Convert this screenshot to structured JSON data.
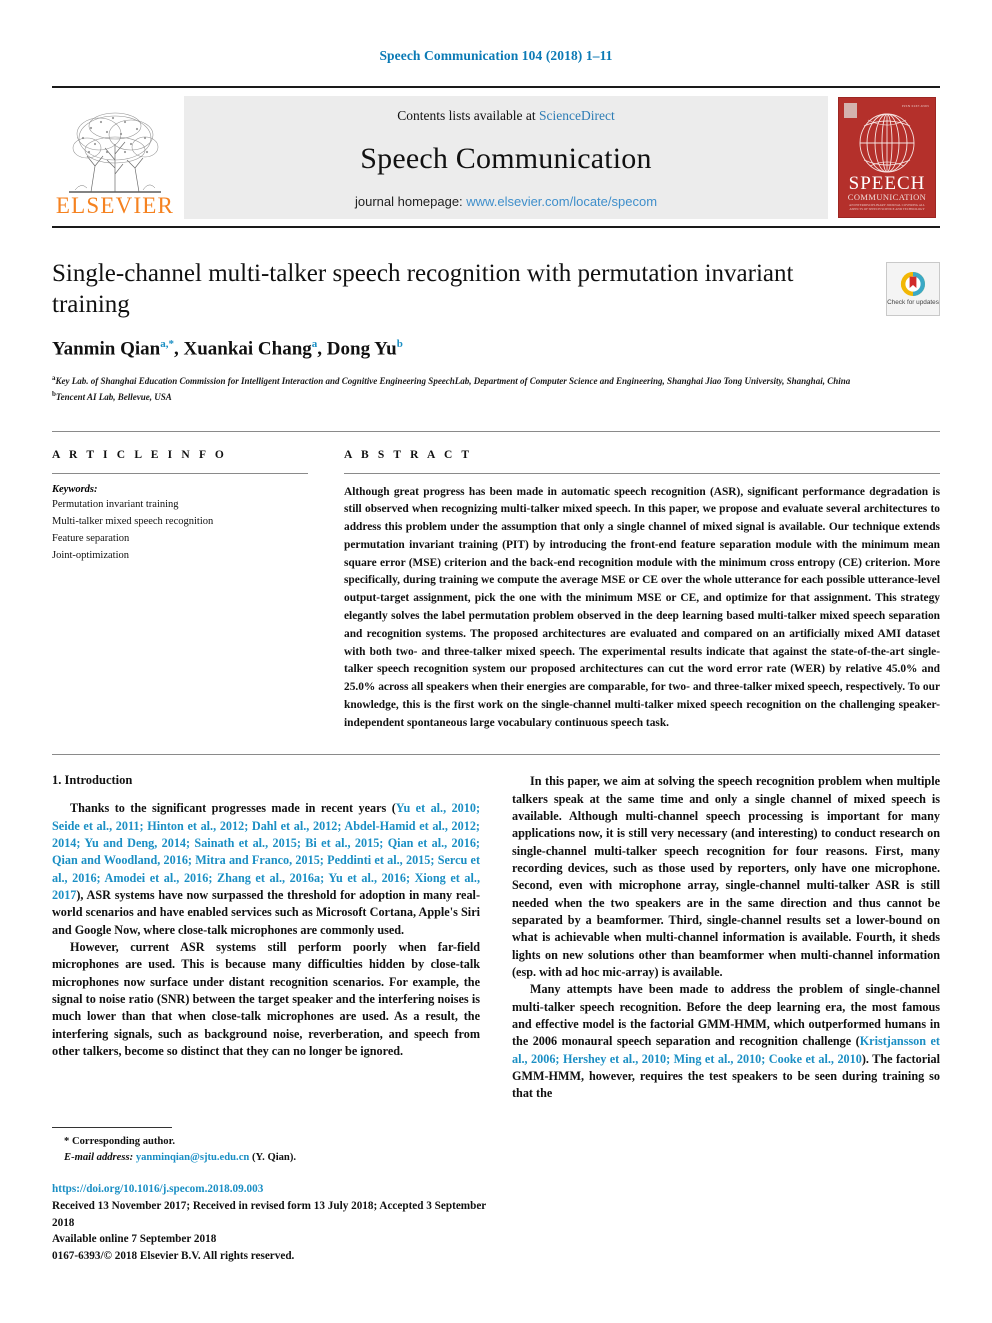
{
  "running_head": "Speech Communication 104 (2018) 1–11",
  "masthead": {
    "publisher_name": "ELSEVIER",
    "contents_prefix": "Contents lists available at ",
    "contents_link": "ScienceDirect",
    "journal_title": "Speech Communication",
    "homepage_prefix": "journal homepage: ",
    "homepage_link": "www.elsevier.com/locate/specom",
    "cover": {
      "title_line1": "SPEECH",
      "title_line2": "COMMUNICATION",
      "fineprint": "AN INTERDISCIPLINARY JOURNAL COVERING ALL ASPECTS OF SPEECH SCIENCE AND TECHNOLOGY",
      "corner_text": "ISSN 0167-6393"
    }
  },
  "article": {
    "title": "Single-channel multi-talker speech recognition with permutation invariant training",
    "crossmark_label": "Check for updates",
    "authors": [
      {
        "name": "Yanmin Qian",
        "marks": "a,*"
      },
      {
        "name": "Xuankai Chang",
        "marks": "a"
      },
      {
        "name": "Dong Yu",
        "marks": "b"
      }
    ],
    "affiliations": [
      {
        "mark": "a",
        "text": "Key Lab. of Shanghai Education Commission for Intelligent Interaction and Cognitive Engineering SpeechLab, Department of Computer Science and Engineering, Shanghai Jiao Tong University, Shanghai, China"
      },
      {
        "mark": "b",
        "text": "Tencent AI Lab, Bellevue, USA"
      }
    ]
  },
  "article_info": {
    "heading": "A R T I C L E   I N F O",
    "keywords_label": "Keywords:",
    "keywords": [
      "Permutation invariant training",
      "Multi-talker mixed speech recognition",
      "Feature separation",
      "Joint-optimization"
    ]
  },
  "abstract": {
    "heading": "A B S T R A C T",
    "text": "Although great progress has been made in automatic speech recognition (ASR), significant performance degradation is still observed when recognizing multi-talker mixed speech. In this paper, we propose and evaluate several architectures to address this problem under the assumption that only a single channel of mixed signal is available. Our technique extends permutation invariant training (PIT) by introducing the front-end feature separation module with the minimum mean square error (MSE) criterion and the back-end recognition module with the minimum cross entropy (CE) criterion. More specifically, during training we compute the average MSE or CE over the whole utterance for each possible utterance-level output-target assignment, pick the one with the minimum MSE or CE, and optimize for that assignment. This strategy elegantly solves the label permutation problem observed in the deep learning based multi-talker mixed speech separation and recognition systems. The proposed architectures are evaluated and compared on an artificially mixed AMI dataset with both two- and three-talker mixed speech. The experimental results indicate that against the state-of-the-art single-talker speech recognition system our proposed architectures can cut the word error rate (WER) by relative 45.0% and 25.0% across all speakers when their energies are comparable, for two- and three-talker mixed speech, respectively. To our knowledge, this is the first work on the single-channel multi-talker mixed speech recognition on the challenging speaker-independent spontaneous large vocabulary continuous speech task."
  },
  "introduction": {
    "section_title": "1. Introduction",
    "left_paragraphs": [
      {
        "segments": [
          {
            "t": "Thanks to the significant progresses made in recent years (",
            "cite": false
          },
          {
            "t": "Yu et al., 2010; Seide et al., 2011; Hinton et al., 2012; Dahl et al., 2012; Abdel-Hamid et al., 2012; 2014; Yu and Deng, 2014; Sainath et al., 2015; Bi et al., 2015; Qian et al., 2016; Qian and Woodland, 2016; Mitra and Franco, 2015; Peddinti et al., 2015; Sercu et al., 2016; Amodei et al., 2016; Zhang et al., 2016a; Yu et al., 2016; Xiong et al., 2017",
            "cite": true
          },
          {
            "t": "), ASR systems have now surpassed the threshold for adoption in many real-world scenarios and have enabled services such as Microsoft Cortana, Apple's Siri and Google Now, where close-talk microphones are commonly used.",
            "cite": false
          }
        ]
      },
      {
        "segments": [
          {
            "t": "However, current ASR systems still perform poorly when far-field microphones are used. This is because many difficulties hidden by close-talk microphones now surface under distant recognition scenarios. For example, the signal to noise ratio (SNR) between the target speaker and the interfering noises is much lower than that when close-talk microphones are used. As a result, the interfering signals, such as background noise, reverberation, and speech from other talkers, become so distinct that they can no longer be ignored.",
            "cite": false
          }
        ]
      }
    ],
    "right_paragraphs": [
      {
        "segments": [
          {
            "t": "In this paper, we aim at solving the speech recognition problem when multiple talkers speak at the same time and only a single channel of mixed speech is available. Although multi-channel speech processing is important for many applications now, it is still very necessary (and interesting) to conduct research on single-channel multi-talker speech recognition for four reasons. First, many recording devices, such as those used by reporters, only have one microphone. Second, even with microphone array, single-channel multi-talker ASR is still needed when the two speakers are in the same direction and thus cannot be separated by a beamformer. Third, single-channel results set a lower-bound on what is achievable when multi-channel information is available. Fourth, it sheds lights on new solutions other than beamformer when multi-channel information (esp. with ad hoc mic-array) is available.",
            "cite": false
          }
        ]
      },
      {
        "segments": [
          {
            "t": "Many attempts have been made to address the problem of single-channel multi-talker speech recognition. Before the deep learning era, the most famous and effective model is the factorial GMM-HMM, which outperformed humans in the 2006 monaural speech separation and recognition challenge (",
            "cite": false
          },
          {
            "t": "Kristjansson et al., 2006; Hershey et al., 2010; Ming et al., 2010; Cooke et al., 2010",
            "cite": true
          },
          {
            "t": "). The factorial GMM-HMM, however, requires the test speakers to be seen during training so that the",
            "cite": false
          }
        ]
      }
    ]
  },
  "footer": {
    "corresponding_marker": "*",
    "corresponding_text": "Corresponding author.",
    "email_label": "E-mail address:",
    "email_link": "yanminqian@sjtu.edu.cn",
    "email_suffix": "(Y. Qian).",
    "doi": "https://doi.org/10.1016/j.specom.2018.09.003",
    "received_line": "Received 13 November 2017; Received in revised form 13 July 2018; Accepted 3 September 2018",
    "available_line": "Available online 7 September 2018",
    "copyright_line": "0167-6393/© 2018 Elsevier B.V. All rights reserved."
  },
  "colors": {
    "link": "#1b8fc4",
    "running_head": "#0b7ab5",
    "elsevier_orange": "#f58220",
    "cover_red": "#b4302b"
  }
}
